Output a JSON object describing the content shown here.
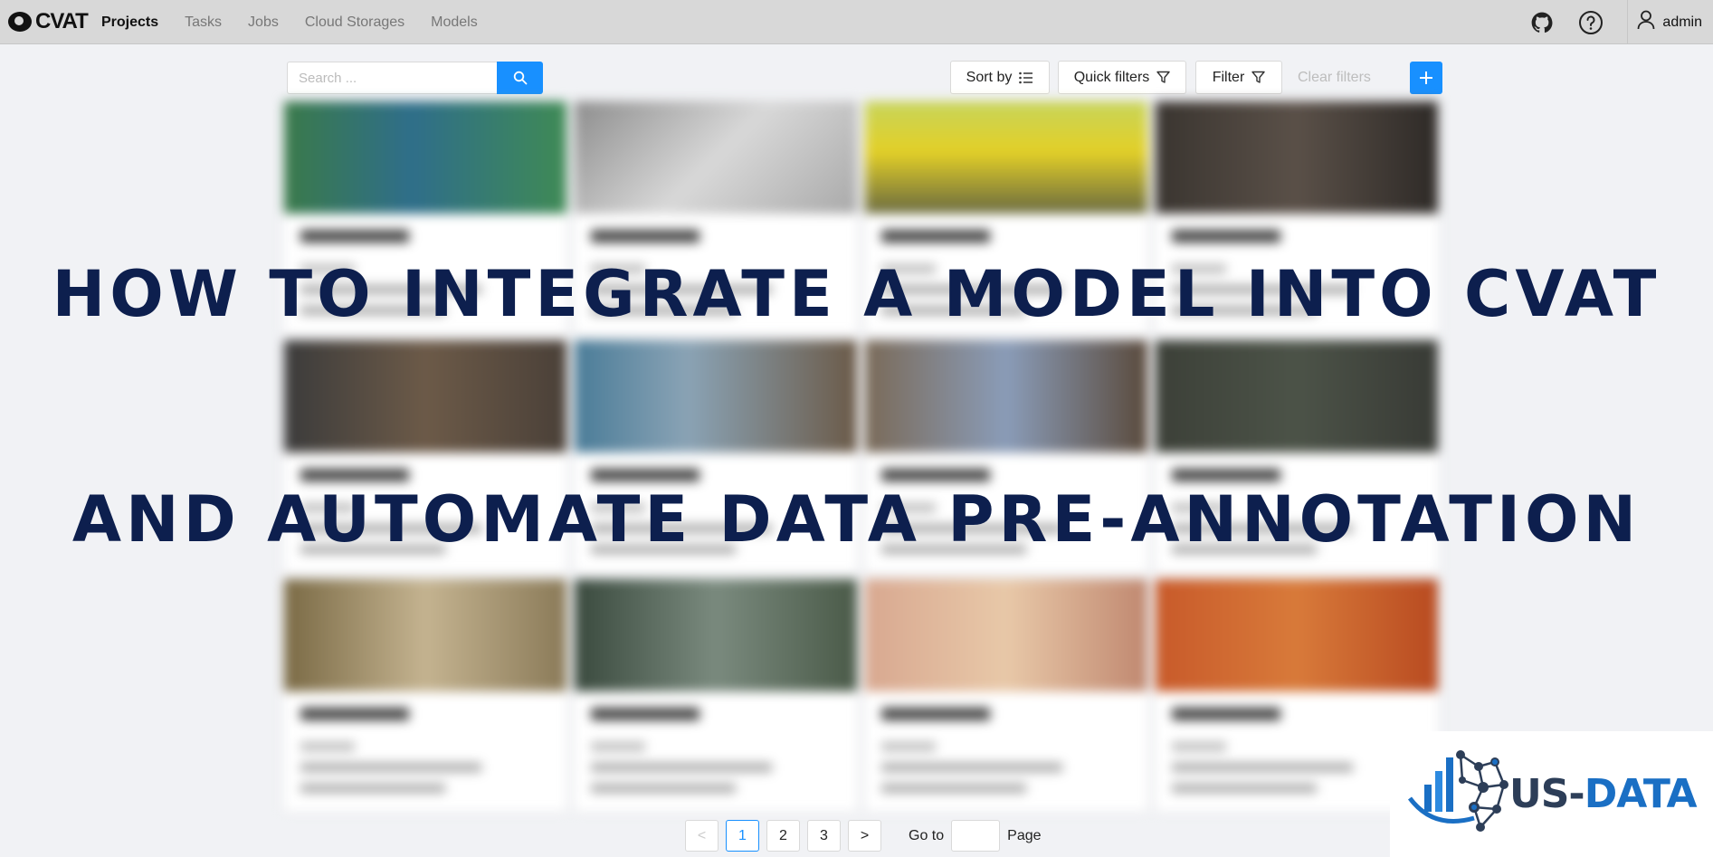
{
  "app": {
    "logo_text": "CVAT"
  },
  "nav": {
    "items": [
      "Projects",
      "Tasks",
      "Jobs",
      "Cloud Storages",
      "Models"
    ],
    "active": "Projects"
  },
  "user": {
    "name": "admin"
  },
  "toolbar": {
    "search_placeholder": "Search ...",
    "sort_label": "Sort by",
    "quick_filters_label": "Quick filters",
    "filter_label": "Filter",
    "clear_filters_label": "Clear filters"
  },
  "headline": {
    "line1": "HOW TO INTEGRATE A MODEL INTO CVAT",
    "line2": "AND AUTOMATE DATA PRE-ANNOTATION"
  },
  "pagination": {
    "pages": [
      "1",
      "2",
      "3"
    ],
    "current": "1",
    "prev": "<",
    "next": ">",
    "goto_label": "Go to",
    "page_label": "Page"
  },
  "brand": {
    "part1": "US-",
    "part2": "DATA"
  },
  "colors": {
    "accent": "#1890ff",
    "headline": "#0d1f4e",
    "brand_dark": "#2d3e58",
    "brand_blue": "#1a6fc4"
  },
  "icons": {
    "github": "github-icon",
    "help": "question-circle-icon",
    "user": "user-icon",
    "search": "search-icon",
    "sort": "sort-list-icon",
    "filter": "funnel-icon",
    "add": "plus-icon"
  }
}
